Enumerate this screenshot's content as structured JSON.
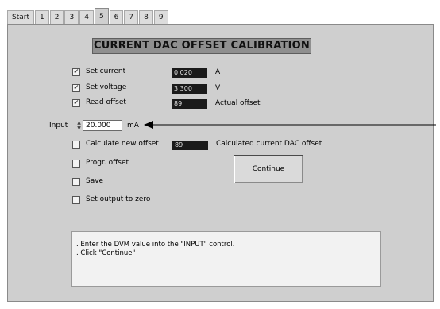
{
  "tabs": [
    "Start",
    "1",
    "2",
    "3",
    "4",
    "5",
    "6",
    "7",
    "8",
    "9"
  ],
  "active_tab": "5",
  "title": "CURRENT DAC OFFSET CALIBRATION",
  "rows": {
    "set_current": {
      "label": "Set current",
      "checked": true,
      "value": "0.020",
      "unit": "A"
    },
    "set_voltage": {
      "label": "Set voltage",
      "checked": true,
      "value": "3.300",
      "unit": "V"
    },
    "read_offset": {
      "label": "Read offset",
      "checked": true,
      "value": "89",
      "unit": "Actual offset"
    }
  },
  "input": {
    "label": "Input",
    "value": "20.000",
    "unit": "mA"
  },
  "calc_offset": {
    "label": "Calculate new offset",
    "checked": false,
    "value": "89",
    "caption": "Calculated current DAC offset"
  },
  "progr_offset": {
    "label": "Progr. offset",
    "checked": false
  },
  "save": {
    "label": "Save",
    "checked": false
  },
  "set_output_zero": {
    "label": "Set output to zero",
    "checked": false
  },
  "continue_label": "Continue",
  "message": {
    "line1": ". Enter the DVM value into the \"INPUT\" control.",
    "line2": ". Click \"Continue\""
  },
  "colors": {
    "panel": "#cfcfcf",
    "title_bg": "#8f8f8f",
    "indicator_bg": "#1a1a1a",
    "message_bg": "#f2f2f2"
  }
}
